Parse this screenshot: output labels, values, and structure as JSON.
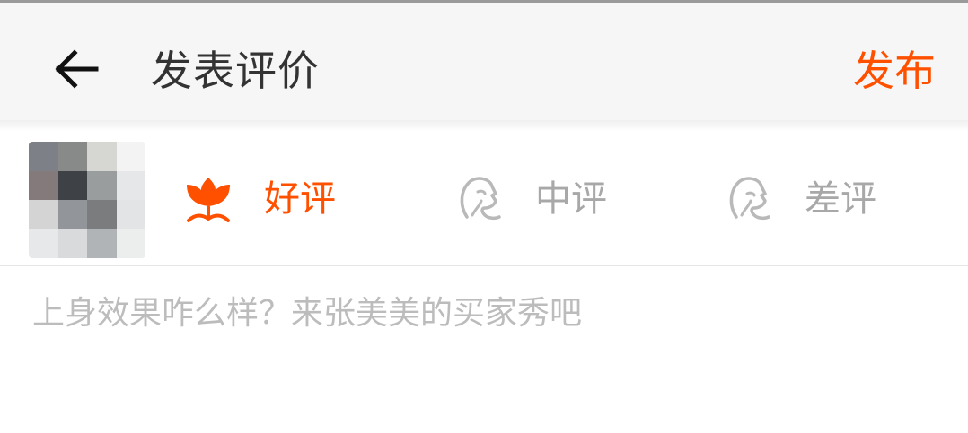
{
  "header": {
    "title": "发表评价",
    "publish_label": "发布",
    "back_icon": "arrow-left-icon"
  },
  "colors": {
    "accent": "#ff5000",
    "inactive": "#b9b9b9",
    "title_text": "#333333",
    "placeholder": "#bcbcbc",
    "header_bg": "#f6f6f6"
  },
  "rating": {
    "selected": "good",
    "options": [
      {
        "key": "good",
        "label": "好评",
        "icon": "flower-icon"
      },
      {
        "key": "medium",
        "label": "中评",
        "icon": "face-profile-icon"
      },
      {
        "key": "bad",
        "label": "差评",
        "icon": "face-profile-icon"
      }
    ]
  },
  "review": {
    "placeholder": "上身效果咋么样？来张美美的买家秀吧",
    "value": ""
  }
}
